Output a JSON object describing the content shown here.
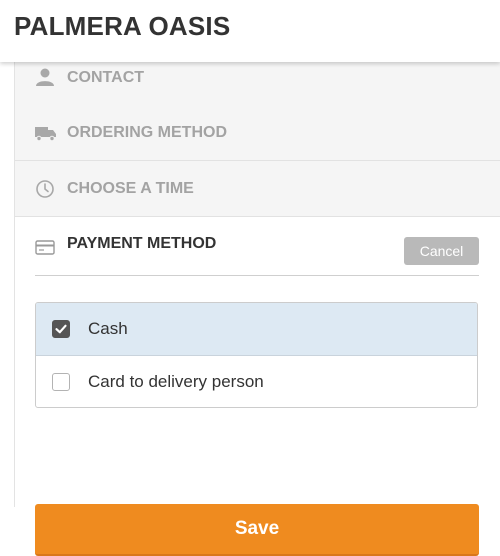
{
  "header": {
    "title": "PALMERA OASIS"
  },
  "steps": [
    {
      "label": "CONTACT",
      "icon": "user-icon"
    },
    {
      "label": "ORDERING METHOD",
      "icon": "delivery-truck-icon"
    },
    {
      "label": "CHOOSE A TIME",
      "icon": "clock-icon"
    }
  ],
  "payment": {
    "label": "PAYMENT METHOD",
    "icon": "credit-card-icon",
    "cancel_label": "Cancel",
    "options": [
      {
        "label": "Cash",
        "checked": true
      },
      {
        "label": "Card to delivery person",
        "checked": false
      }
    ],
    "save_label": "Save"
  },
  "colors": {
    "accent": "#ef8b1f",
    "selected_bg": "#dde9f3",
    "muted_text": "#a3a3a3",
    "dark_text": "#333333"
  }
}
